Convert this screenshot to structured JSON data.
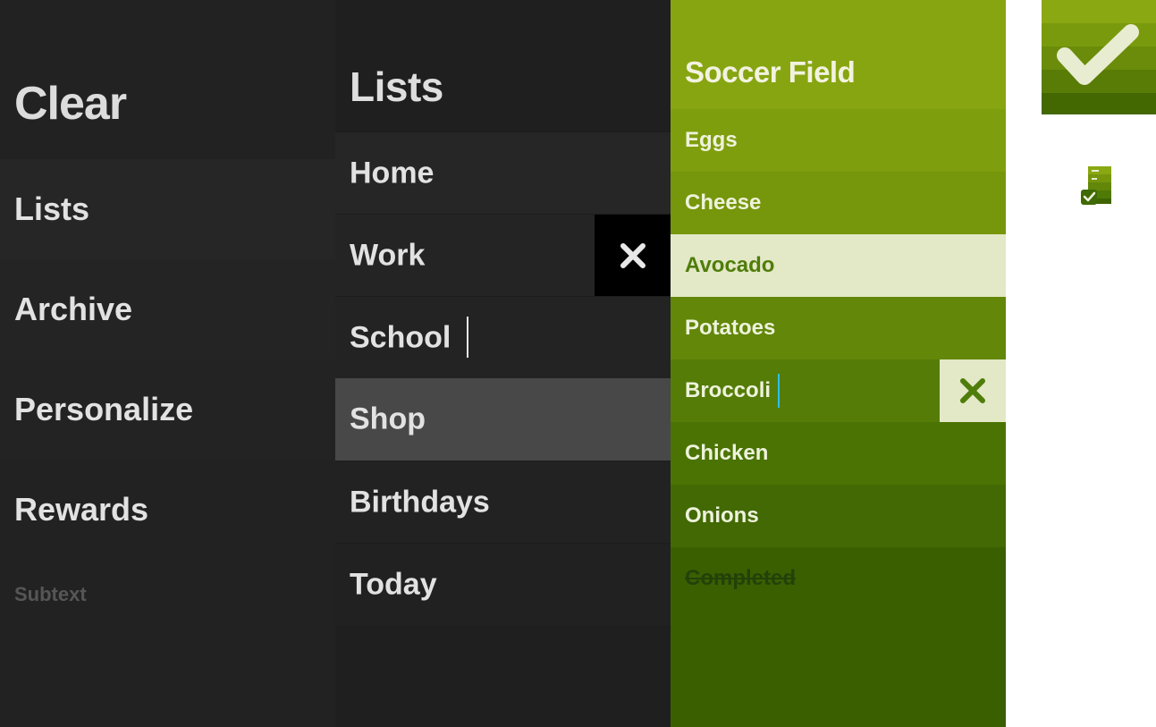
{
  "menu": {
    "app_title": "Clear",
    "items": [
      {
        "label": "Lists"
      },
      {
        "label": "Archive"
      },
      {
        "label": "Personalize"
      },
      {
        "label": "Rewards"
      }
    ],
    "subtext": "Subtext"
  },
  "lists": {
    "title": "Lists",
    "rows": [
      {
        "label": "Home"
      },
      {
        "label": "Work"
      },
      {
        "label": "School"
      },
      {
        "label": "Shop"
      },
      {
        "label": "Birthdays"
      },
      {
        "label": "Today"
      }
    ],
    "delete_icon": "close-icon"
  },
  "list_detail": {
    "title": "Soccer Field",
    "items": [
      {
        "label": "Eggs"
      },
      {
        "label": "Cheese"
      },
      {
        "label": "Avocado"
      },
      {
        "label": "Potatoes"
      },
      {
        "label": "Broccoli"
      },
      {
        "label": "Chicken"
      },
      {
        "label": "Onions"
      },
      {
        "label": "Completed",
        "completed": true
      }
    ],
    "delete_icon": "close-icon"
  },
  "icons": {
    "app_icon_large": "checkmark-icon",
    "app_icon_small": "checklist-icon"
  },
  "colors": {
    "dark_background": "#222222",
    "highlight_row": "#484848",
    "green_accent": "#87a510",
    "green_dark": "#3a5f00",
    "selected_item": "#e3e8c6",
    "cursor_blue": "#2ec0f0"
  }
}
